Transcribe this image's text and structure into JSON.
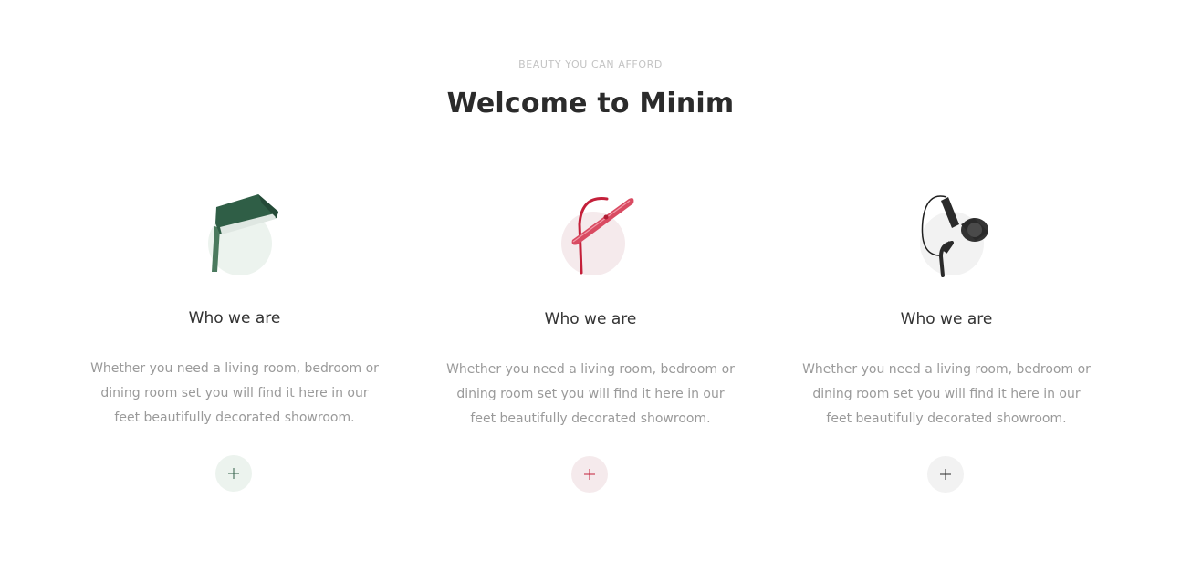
{
  "section": {
    "eyebrow": "BEAUTY YOU CAN AFFORD",
    "title": "Welcome to Minim"
  },
  "cards": [
    {
      "icon": "green-desk-lamp-icon",
      "title": "Who we are",
      "text": "Whether you need a living room, bedroom or dining room set you will find it here in our feet beautifully decorated showroom.",
      "button_icon": "plus-icon",
      "accent": "#2f5e46",
      "circle_bg": "#ecf3ee"
    },
    {
      "icon": "red-floor-lamp-icon",
      "title": "Who we are",
      "text": "Whether you need a living room, bedroom or dining room set you will find it here in our feet beautifully decorated showroom.",
      "button_icon": "plus-icon",
      "accent": "#c4203a",
      "circle_bg": "#f5eaec"
    },
    {
      "icon": "black-wall-lamp-icon",
      "title": "Who we are",
      "text": "Whether you need a living room, bedroom or dining room set you will find it here in our feet beautifully decorated showroom.",
      "button_icon": "plus-icon",
      "accent": "#2a2a2a",
      "circle_bg": "#f2f2f2"
    }
  ]
}
